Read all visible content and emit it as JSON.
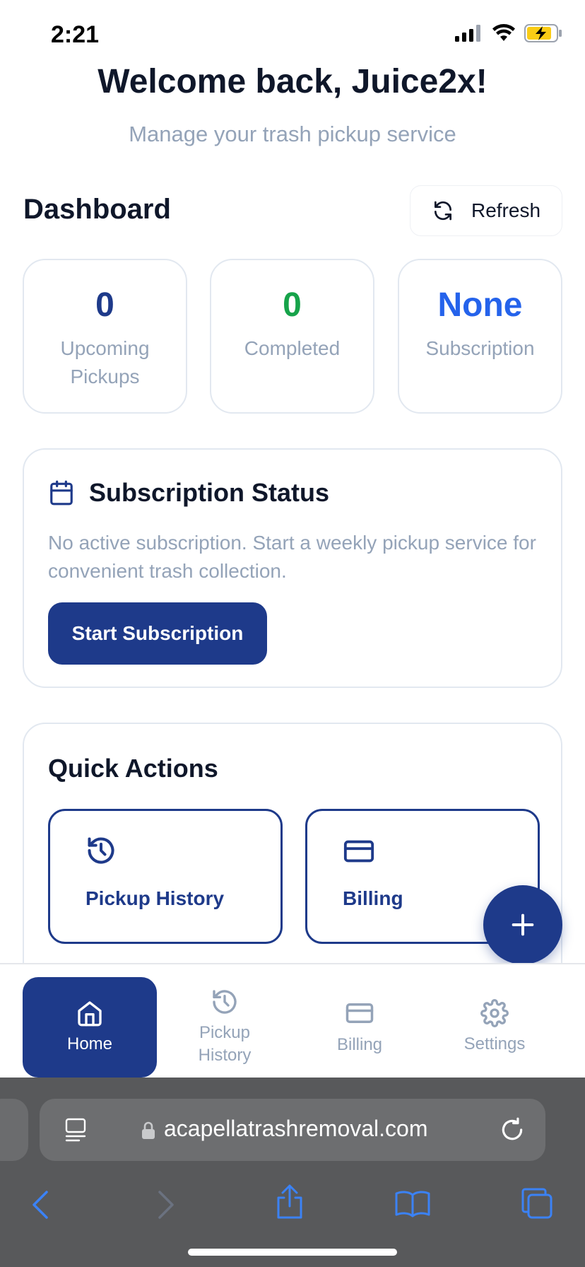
{
  "status_bar": {
    "time": "2:21"
  },
  "header": {
    "welcome": "Welcome back, Juice2x!",
    "subtitle": "Manage your trash pickup service"
  },
  "dashboard": {
    "title": "Dashboard",
    "refresh_label": "Refresh",
    "stats": [
      {
        "value": "0",
        "label": "Upcoming Pickups",
        "color": "#1e3a8a"
      },
      {
        "value": "0",
        "label": "Completed",
        "color": "#16a34a"
      },
      {
        "value": "None",
        "label": "Subscription",
        "color": "#2563eb"
      }
    ]
  },
  "subscription": {
    "title": "Subscription Status",
    "text": "No active subscription. Start a weekly pickup service for convenient trash collection.",
    "button": "Start Subscription"
  },
  "quick_actions": {
    "title": "Quick Actions",
    "tiles": [
      {
        "label": "Pickup History",
        "icon": "history-icon"
      },
      {
        "label": "Billing",
        "icon": "credit-card-icon"
      }
    ]
  },
  "tab_bar": {
    "tabs": [
      {
        "label": "Home",
        "icon": "home-icon",
        "active": true
      },
      {
        "label": "Pickup History",
        "icon": "history-icon",
        "active": false
      },
      {
        "label": "Billing",
        "icon": "credit-card-icon",
        "active": false
      },
      {
        "label": "Settings",
        "icon": "gear-icon",
        "active": false
      }
    ]
  },
  "browser": {
    "url": "acapellatrashremoval.com"
  },
  "colors": {
    "primary": "#1e3a8a",
    "success": "#16a34a",
    "accent_blue": "#2563eb",
    "muted_text": "#94a3b8",
    "browser_bar": "#58595b",
    "battery_charging": "#facc15",
    "browser_icon": "#3b82f6"
  }
}
